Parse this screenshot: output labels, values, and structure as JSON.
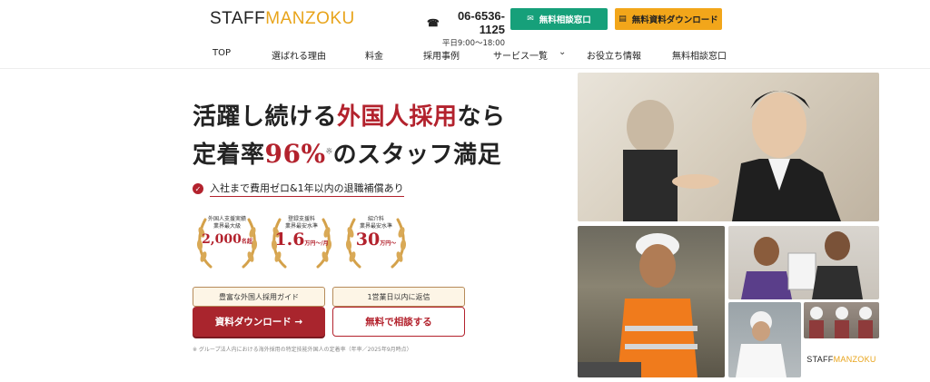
{
  "header": {
    "logo_main": "STAFF",
    "logo_accent": "MANZOKU",
    "phone_icon": "☎",
    "phone": "06-6536-1125",
    "hours": "平日9:00〜18:00",
    "consult_btn": "無料相談窓口",
    "download_btn": "無料資料ダウンロード"
  },
  "nav": {
    "items": [
      "TOP",
      "選ばれる理由",
      "料金",
      "採用事例",
      "サービス一覧",
      "お役立ち情報",
      "無料相談窓口"
    ]
  },
  "hero": {
    "line1_a": "活躍し続ける",
    "line1_b": "外国人採用",
    "line1_c": "なら",
    "line2_a": "定着率",
    "line2_b": "96%",
    "line2_sup": "※",
    "line2_c": "のスタッフ満足",
    "check_text": "入社まで費用ゼロ&1年以内の退職補償あり"
  },
  "badges": [
    {
      "line1": "外国人支援実績",
      "line2": "業界最大級",
      "value": "2,000",
      "unit": "名超"
    },
    {
      "line1": "登録支援料",
      "line2": "業界最安水準",
      "value": "1.6",
      "unit": "万円〜/月"
    },
    {
      "line1": "紹介料",
      "line2": "業界最安水準",
      "value": "30",
      "unit": "万円〜"
    }
  ],
  "cta": {
    "left_tag": "豊富な外国人採用ガイド",
    "right_tag": "1営業日以内に返信",
    "primary": "資料ダウンロード →",
    "secondary": "無料で相談する",
    "footnote": "※ グループ法人内における海外採用の特定技能外国人の定着率（年率／2025年9月時点）"
  },
  "photos": {
    "logo_main": "STAFF",
    "logo_accent": "MANZOKU"
  },
  "colors": {
    "brand_red": "#b3222d",
    "brand_green": "#16a07a",
    "brand_yellow": "#f2a61a",
    "logo_accent": "#e8a41b"
  }
}
